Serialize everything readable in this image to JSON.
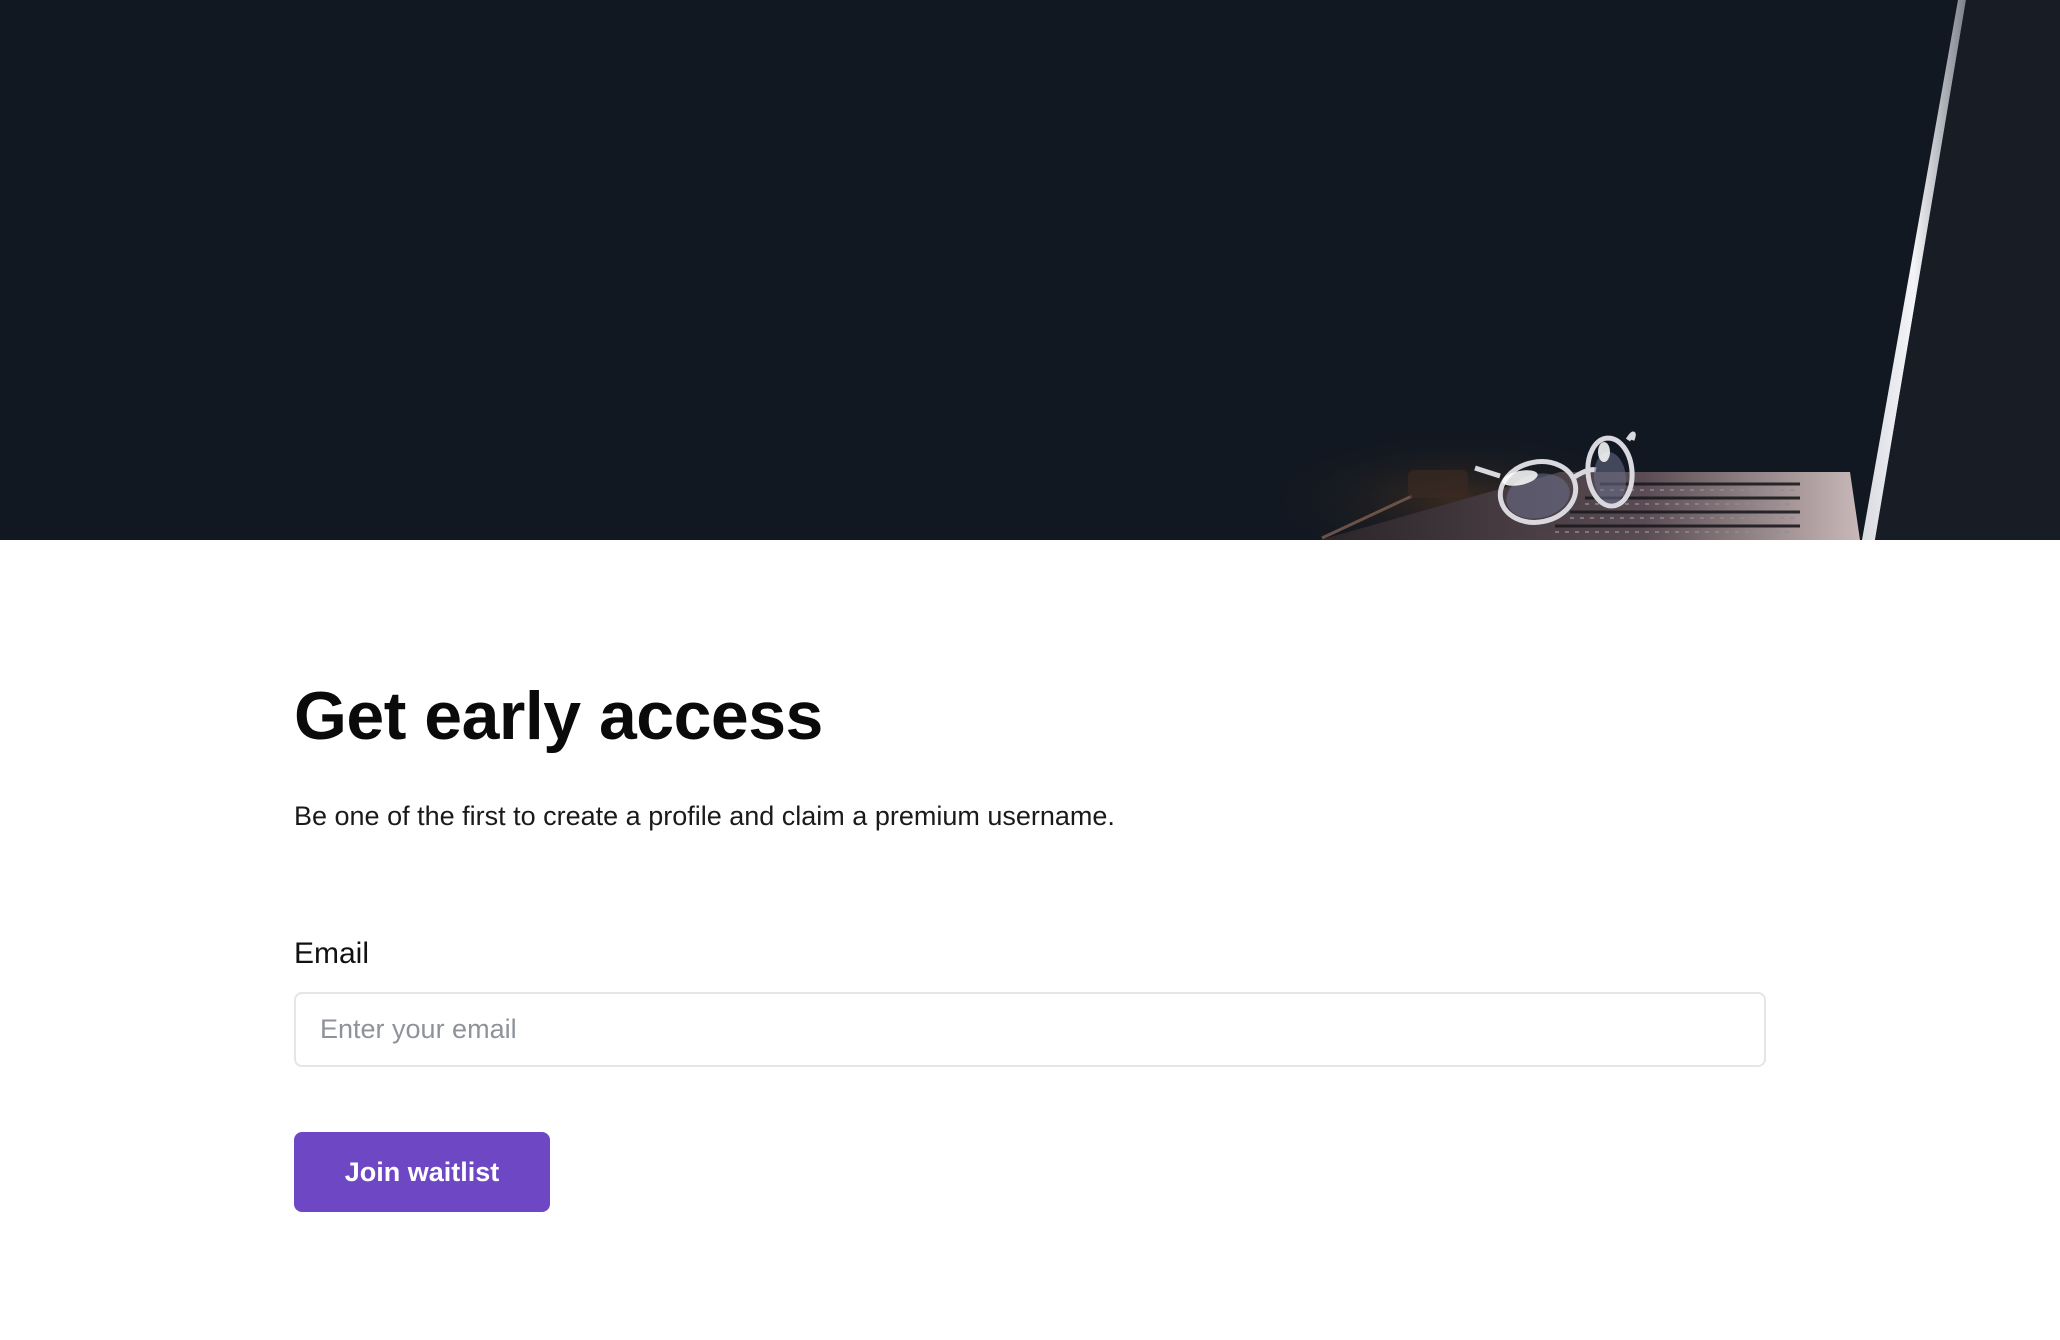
{
  "hero": {
    "image": "laptop-and-glasses-photo"
  },
  "form": {
    "title": "Get early access",
    "subtitle": "Be one of the first to create a profile and claim a premium username.",
    "email_label": "Email",
    "email_placeholder": "Enter your email",
    "email_value": "",
    "submit_label": "Join waitlist"
  },
  "colors": {
    "hero_background": "#121821",
    "button_background": "#6e48c4",
    "button_text": "#ffffff"
  }
}
